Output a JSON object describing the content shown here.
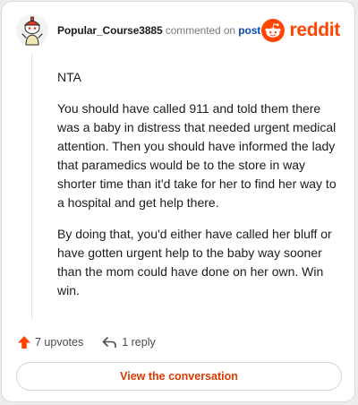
{
  "header": {
    "username": "Popular_Course3885",
    "commented_on_text": "commented on",
    "post_link": "post",
    "brand_name": "reddit"
  },
  "comment": {
    "paragraphs": [
      "NTA",
      "You should have called 911 and told them there was a baby in distress that needed urgent medical attention. Then you should have informed the lady that paramedics would be to the store in way shorter time than it'd take for her to find her way to a hospital and get help there.",
      "By doing that, you'd either have called her bluff or have gotten urgent help to the baby way sooner than the mom could have done on her own. Win win."
    ]
  },
  "actions": {
    "upvotes": "7 upvotes",
    "replies": "1 reply"
  },
  "view_button": "View the conversation",
  "colors": {
    "brand_orange": "#ff4500",
    "upvote_arrow": "#ff4500",
    "link_blue": "#0a4ab4",
    "button_text": "#d93a00"
  },
  "icons": {
    "avatar": "snoo-avatar",
    "brand": "reddit-logo-icon",
    "upvote": "upvote-arrow-icon",
    "reply": "reply-arrow-icon"
  }
}
